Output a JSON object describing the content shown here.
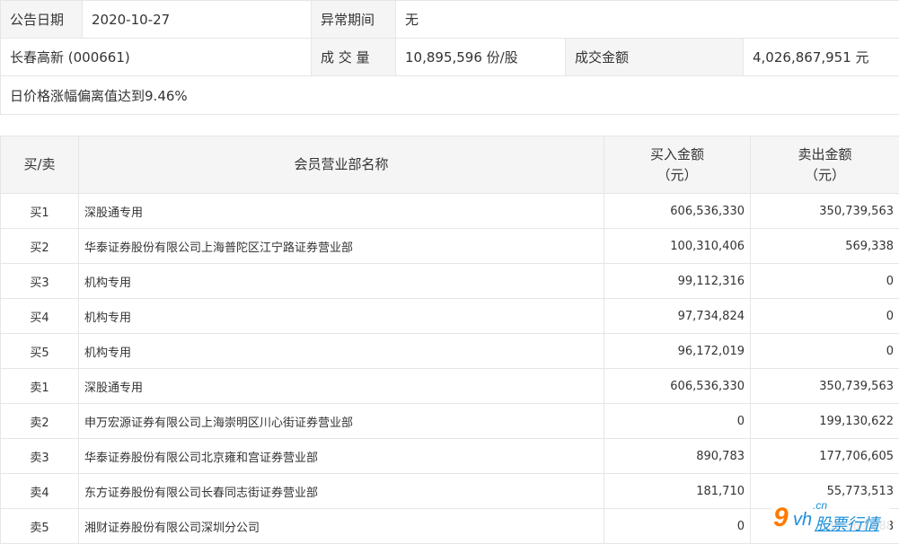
{
  "info": {
    "announce_date_label": "公告日期",
    "announce_date": "2020-10-27",
    "abnormal_period_label": "异常期间",
    "abnormal_period": "无",
    "stock": "长春高新 (000661)",
    "volume_label": "成 交 量",
    "volume": "10,895,596 份/股",
    "amount_label": "成交金额",
    "amount": "4,026,867,951 元",
    "reason": "日价格涨幅偏离值达到9.46%"
  },
  "table": {
    "headers": {
      "side": "买/卖",
      "member": "会员营业部名称",
      "buy_amount": "买入金额",
      "buy_unit": "（元）",
      "sell_amount": "卖出金额",
      "sell_unit": "（元）"
    },
    "rows": [
      {
        "side": "买1",
        "member": "深股通专用",
        "buy": "606,536,330",
        "sell": "350,739,563"
      },
      {
        "side": "买2",
        "member": "华泰证券股份有限公司上海普陀区江宁路证券营业部",
        "buy": "100,310,406",
        "sell": "569,338"
      },
      {
        "side": "买3",
        "member": "机构专用",
        "buy": "99,112,316",
        "sell": "0"
      },
      {
        "side": "买4",
        "member": "机构专用",
        "buy": "97,734,824",
        "sell": "0"
      },
      {
        "side": "买5",
        "member": "机构专用",
        "buy": "96,172,019",
        "sell": "0"
      },
      {
        "side": "卖1",
        "member": "深股通专用",
        "buy": "606,536,330",
        "sell": "350,739,563"
      },
      {
        "side": "卖2",
        "member": "申万宏源证券有限公司上海崇明区川心街证券营业部",
        "buy": "0",
        "sell": "199,130,622"
      },
      {
        "side": "卖3",
        "member": "华泰证券股份有限公司北京雍和宫证券营业部",
        "buy": "890,783",
        "sell": "177,706,605"
      },
      {
        "side": "卖4",
        "member": "东方证券股份有限公司长春同志街证券营业部",
        "buy": "181,710",
        "sell": "55,773,513"
      },
      {
        "side": "卖5",
        "member": "湘财证券股份有限公司深圳分公司",
        "buy": "0",
        "sell": "38,669,888"
      }
    ]
  },
  "watermark": {
    "nine": "9",
    "vh": "vh",
    "cn": ".cn",
    "text": "股票行情"
  }
}
